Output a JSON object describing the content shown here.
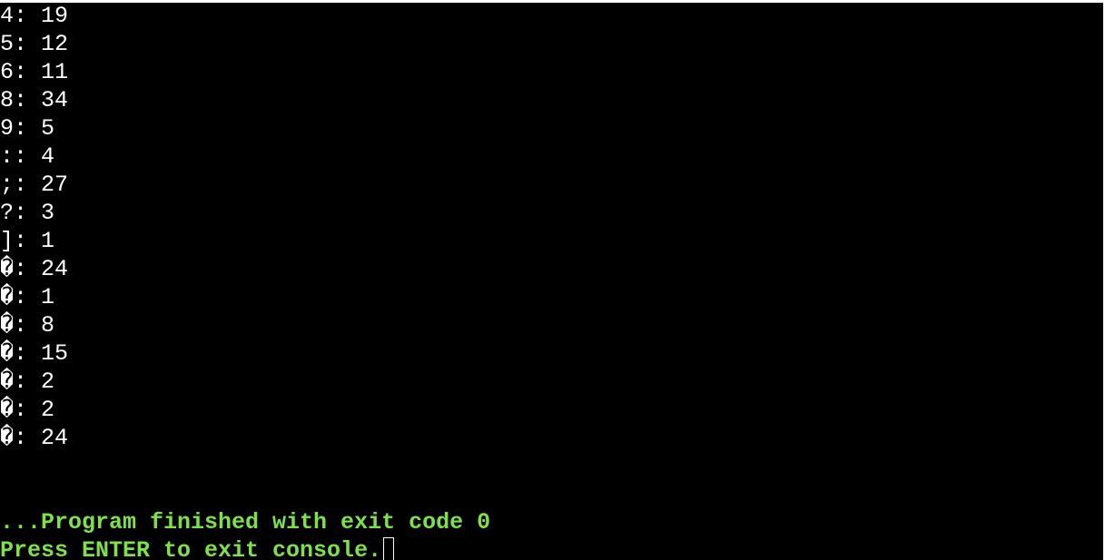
{
  "output_lines": [
    "4: 19",
    "5: 12",
    "6: 11",
    "8: 34",
    "9: 5",
    ":: 4",
    ";: 27",
    "?: 3",
    "]: 1",
    "�: 24",
    "�: 1",
    "�: 8",
    "�: 15",
    "�: 2",
    "�: 2",
    "�: 24"
  ],
  "status": {
    "finished_message": "...Program finished with exit code 0",
    "prompt_message": "Press ENTER to exit console."
  },
  "colors": {
    "background": "#000000",
    "text": "#ffffff",
    "status_text": "#7ee04c"
  }
}
